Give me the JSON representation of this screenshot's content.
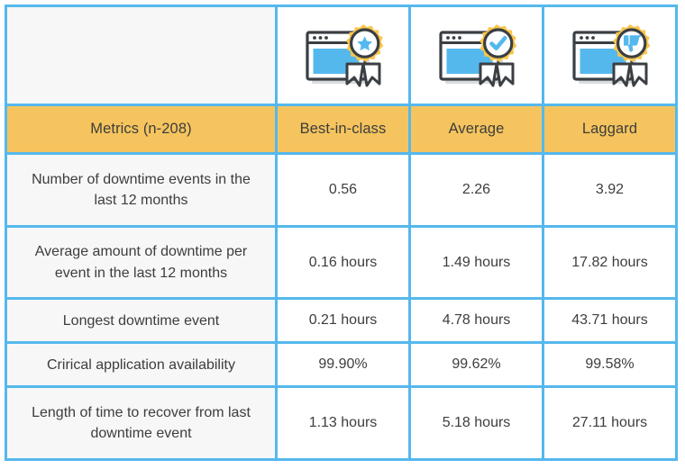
{
  "table": {
    "icon_row": {
      "metric_cell": "",
      "icons": [
        {
          "name": "award-badge-star-icon",
          "symbol": "star",
          "alt": "Best-in-class award badge with star"
        },
        {
          "name": "award-badge-check-icon",
          "symbol": "check",
          "alt": "Average award badge with checkmark"
        },
        {
          "name": "award-badge-thumbs-down-icon",
          "symbol": "thumbs-down",
          "alt": "Laggard award badge with thumbs down"
        }
      ]
    },
    "header": {
      "metric_label": "Metrics (n-208)",
      "columns": [
        "Best-in-class",
        "Average",
        "Laggard"
      ]
    },
    "rows": [
      {
        "metric": "Number of downtime events in the last 12 months",
        "values": [
          "0.56",
          "2.26",
          "3.92"
        ]
      },
      {
        "metric": "Average amount of downtime per event in the last 12 months",
        "values": [
          "0.16 hours",
          "1.49 hours",
          "17.82 hours"
        ]
      },
      {
        "metric": "Longest downtime event",
        "values": [
          "0.21 hours",
          "4.78 hours",
          "43.71 hours"
        ]
      },
      {
        "metric": "Crirical application availability",
        "values": [
          "99.90%",
          "99.62%",
          "99.58%"
        ]
      },
      {
        "metric": "Length of time to recover from last downtime event",
        "values": [
          "1.13 hours",
          "5.18 hours",
          "27.11 hours"
        ]
      }
    ]
  },
  "colors": {
    "border": "#55b8ed",
    "header_background": "#f5c45e",
    "metric_column_background": "#f7f7f7",
    "value_background": "#ffffff",
    "text": "#3d3d3d",
    "icon_blue": "#55b8ed",
    "icon_gold": "#f9c64c",
    "icon_dark": "#3a3f44"
  }
}
